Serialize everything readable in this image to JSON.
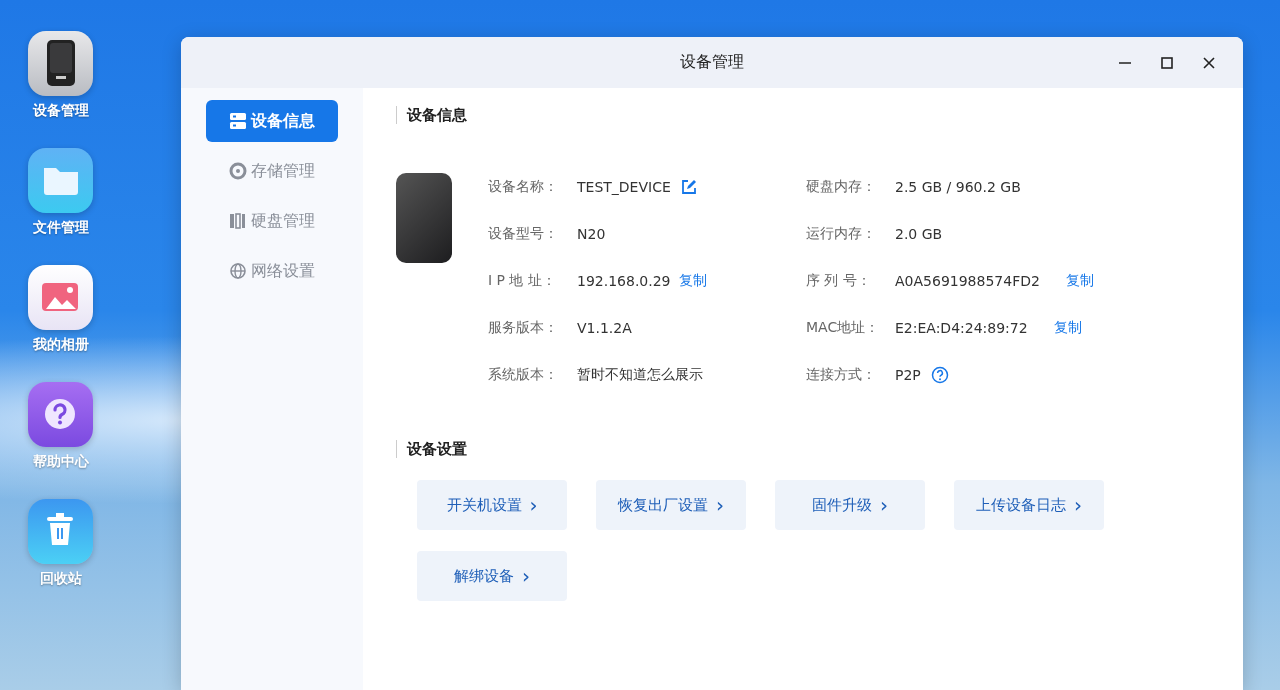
{
  "desktop_icons": [
    {
      "kind": "device",
      "label": "设备管理"
    },
    {
      "kind": "folder",
      "label": "文件管理"
    },
    {
      "kind": "photo",
      "label": "我的相册"
    },
    {
      "kind": "help",
      "label": "帮助中心"
    },
    {
      "kind": "trash",
      "label": "回收站"
    }
  ],
  "window": {
    "title": "设备管理"
  },
  "sidebar": {
    "items": [
      {
        "kind": "info",
        "label": "设备信息",
        "selected": true
      },
      {
        "kind": "storage",
        "label": "存储管理",
        "selected": false
      },
      {
        "kind": "disk",
        "label": "硬盘管理",
        "selected": false
      },
      {
        "kind": "network",
        "label": "网络设置",
        "selected": false
      }
    ]
  },
  "device_info": {
    "title": "设备信息",
    "fields": [
      {
        "kind": "editable",
        "label": "设备名称：",
        "value": "TEST_DEVICE"
      },
      {
        "label": "硬盘内存：",
        "value": "2.5 GB / 960.2 GB"
      },
      {
        "label": "设备型号：",
        "value": "N20"
      },
      {
        "label": "运行内存：",
        "value": "2.0 GB"
      },
      {
        "label": "I P 地 址：",
        "value": "192.168.0.29",
        "action": "复制"
      },
      {
        "label": "序 列 号：",
        "value": "A0A5691988574FD2",
        "action": "复制"
      },
      {
        "label": "服务版本：",
        "value": "V1.1.2A"
      },
      {
        "label": "MAC地址：",
        "value": "E2:EA:D4:24:89:72",
        "action": "复制"
      },
      {
        "label": "系统版本：",
        "value": "暂时不知道怎么展示"
      },
      {
        "kind": "help",
        "label": "连接方式：",
        "value": "P2P"
      }
    ]
  },
  "device_settings": {
    "title": "设备设置",
    "buttons": [
      {
        "label": "开关机设置",
        "arrow": "›"
      },
      {
        "label": "恢复出厂设置",
        "arrow": "›"
      },
      {
        "label": "固件升级",
        "arrow": "›"
      },
      {
        "label": "上传设备日志",
        "arrow": "›"
      },
      {
        "label": "解绑设备",
        "arrow": "›"
      }
    ]
  }
}
